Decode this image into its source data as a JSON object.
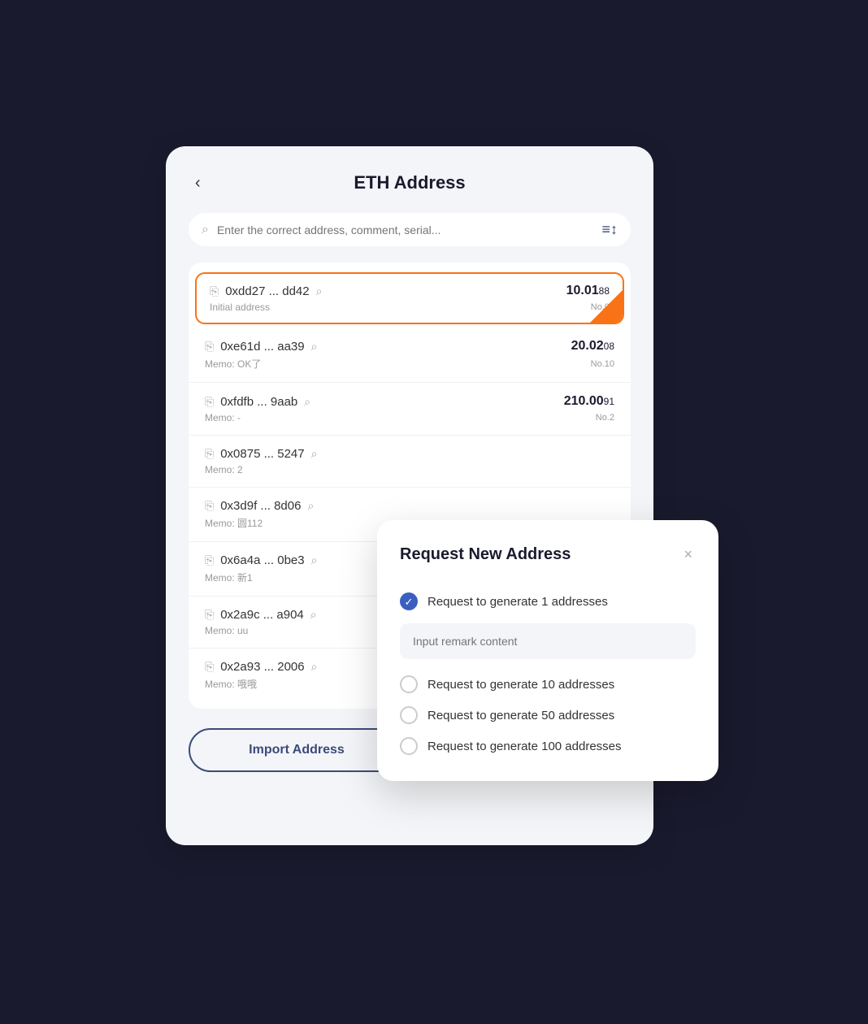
{
  "page": {
    "title": "ETH Address",
    "back_label": "‹"
  },
  "search": {
    "placeholder": "Enter the correct address, comment, serial..."
  },
  "addresses": [
    {
      "id": 1,
      "address": "0xdd27 ... dd42",
      "memo": "Initial address",
      "amount_main": "10.01",
      "amount_small": "88",
      "no": "No.0",
      "active": true
    },
    {
      "id": 2,
      "address": "0xe61d ... aa39",
      "memo": "Memo: OK了",
      "amount_main": "20.02",
      "amount_small": "08",
      "no": "No.10",
      "active": false
    },
    {
      "id": 3,
      "address": "0xfdfb ... 9aab",
      "memo": "Memo: -",
      "amount_main": "210.00",
      "amount_small": "91",
      "no": "No.2",
      "active": false
    },
    {
      "id": 4,
      "address": "0x0875 ... 5247",
      "memo": "Memo: 2",
      "amount_main": "",
      "amount_small": "",
      "no": "",
      "active": false
    },
    {
      "id": 5,
      "address": "0x3d9f ... 8d06",
      "memo": "Memo: 圆112",
      "amount_main": "",
      "amount_small": "",
      "no": "",
      "active": false
    },
    {
      "id": 6,
      "address": "0x6a4a ... 0be3",
      "memo": "Memo: 新1",
      "amount_main": "",
      "amount_small": "",
      "no": "",
      "active": false
    },
    {
      "id": 7,
      "address": "0x2a9c ... a904",
      "memo": "Memo: uu",
      "amount_main": "",
      "amount_small": "",
      "no": "",
      "active": false
    },
    {
      "id": 8,
      "address": "0x2a93 ... 2006",
      "memo": "Memo: 哦哦",
      "amount_main": "",
      "amount_small": "",
      "no": "",
      "active": false
    }
  ],
  "buttons": {
    "import": "Import Address",
    "request": "Request New Address"
  },
  "modal": {
    "title": "Request New Address",
    "close_icon": "×",
    "remark_placeholder": "Input remark content",
    "options": [
      {
        "id": 1,
        "label": "Request to generate 1 addresses",
        "checked": true
      },
      {
        "id": 2,
        "label": "Request to generate 10 addresses",
        "checked": false
      },
      {
        "id": 3,
        "label": "Request to generate 50 addresses",
        "checked": false
      },
      {
        "id": 4,
        "label": "Request to generate 100 addresses",
        "checked": false
      }
    ]
  }
}
